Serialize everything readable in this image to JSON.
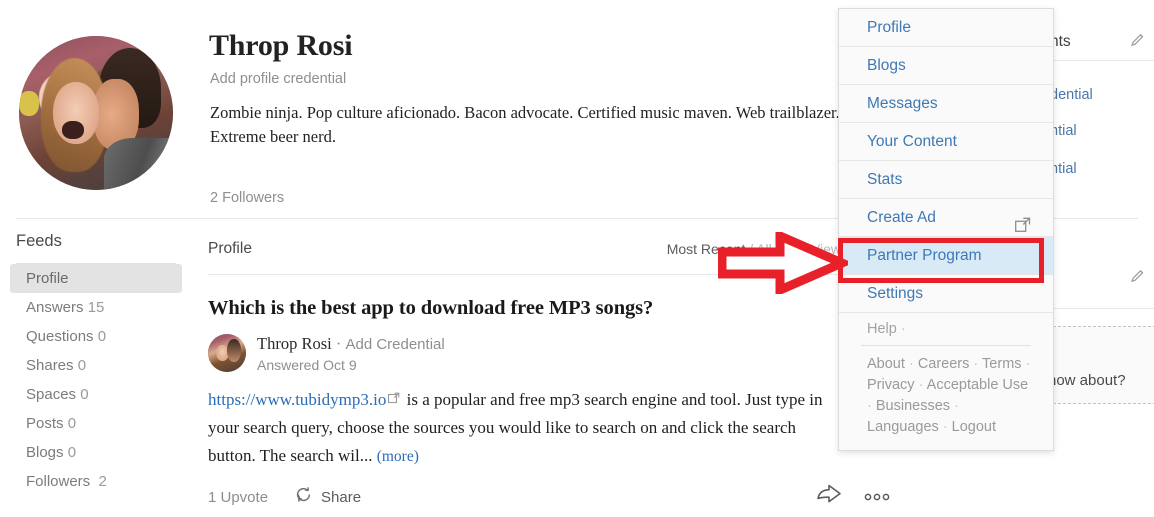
{
  "profile": {
    "name": "Throp Rosi",
    "add_credential": "Add profile credential",
    "bio": "Zombie ninja. Pop culture aficionado. Bacon advocate. Certified music maven. Web trailblazer. Extreme beer nerd.",
    "followers": "2 Followers",
    "avatar_alt": "profile-photo"
  },
  "sidebar": {
    "title": "Feeds",
    "items": [
      {
        "label": "Profile",
        "count": "",
        "active": true
      },
      {
        "label": "Answers",
        "count": "15",
        "active": false
      },
      {
        "label": "Questions",
        "count": "0",
        "active": false
      },
      {
        "label": "Shares",
        "count": "0",
        "active": false
      },
      {
        "label": "Spaces",
        "count": "0",
        "active": false
      },
      {
        "label": "Posts",
        "count": "0",
        "active": false
      },
      {
        "label": "Blogs",
        "count": "0",
        "active": false
      },
      {
        "label": "Followers",
        "count": "2",
        "active": false
      }
    ]
  },
  "main": {
    "tab_label": "Profile",
    "sort_primary": "Most Recent",
    "sort_separator": "/",
    "sort_secondary": "All-Time Views",
    "question_title": "Which is the best app to download free MP3 songs?",
    "answer": {
      "author": "Throp Rosi",
      "author_sep": "·",
      "author_credential": "Add Credential",
      "answered": "Answered Oct 9",
      "link_text": "https://www.tubidymp3.io",
      "body_text": " is a popular and free mp3 search engine and tool. Just type in your search query, choose the sources you would like to search on and click the search button. The search wil...",
      "more_label": "(more)",
      "upvote_label": "1 Upvote",
      "share_label": "Share"
    }
  },
  "right_rail": {
    "heading": "nts",
    "credentials": [
      "dential",
      "ntial",
      "ntial"
    ],
    "box_text": "now about?"
  },
  "dropdown": {
    "items": [
      {
        "label": "Profile",
        "external": false,
        "highlighted": false
      },
      {
        "label": "Blogs",
        "external": false,
        "highlighted": false
      },
      {
        "label": "Messages",
        "external": false,
        "highlighted": false
      },
      {
        "label": "Your Content",
        "external": false,
        "highlighted": false
      },
      {
        "label": "Stats",
        "external": false,
        "highlighted": false
      },
      {
        "label": "Create Ad",
        "external": true,
        "highlighted": false
      },
      {
        "label": "Partner Program",
        "external": false,
        "highlighted": true
      },
      {
        "label": "Settings",
        "external": false,
        "highlighted": false
      }
    ],
    "help_label": "Help",
    "help_sep": "·",
    "footer_links": [
      "About",
      "Careers",
      "Terms",
      "Privacy",
      "Acceptable Use",
      "Businesses",
      "Languages",
      "Logout"
    ],
    "footer_sep": "·"
  },
  "annotation": {
    "arrow_color": "#e8202a",
    "highlight_color": "#e8202a",
    "target_label": "Partner Program"
  },
  "colors": {
    "link_blue": "#3f78b5",
    "answer_link_blue": "#2b6cb8",
    "text_dark": "#222222",
    "text_muted": "#8f8f8f",
    "highlight_bg": "#d9eaf7",
    "sidebar_active_bg": "#e3e3e3"
  }
}
